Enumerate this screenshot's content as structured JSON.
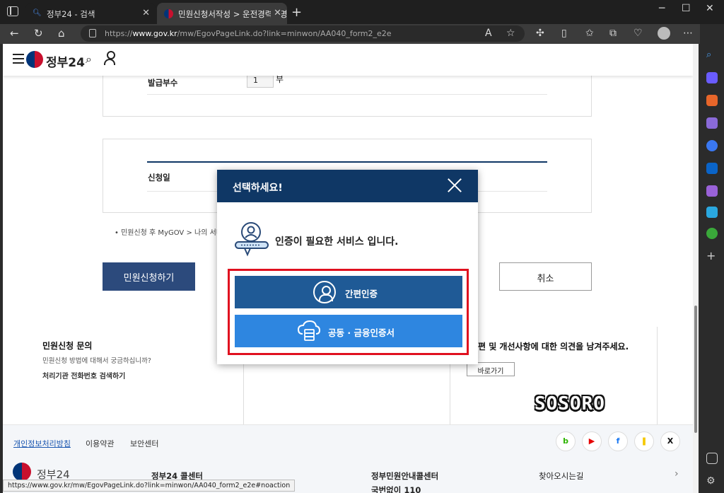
{
  "browser": {
    "tabs": [
      {
        "title": "정부24 - 검색",
        "active": false
      },
      {
        "title": "민원신청서작성 > 운전경력증명",
        "active": true
      }
    ],
    "address": {
      "prefix": "https://",
      "host": "www.gov.kr",
      "path": "/mw/EgovPageLink.do?link=minwon/AA040_form2_e2e"
    },
    "status_url": "https://www.gov.kr/mw/EgovPageLink.do?link=minwon/AA040_form2_e2e#noaction"
  },
  "site": {
    "logo": "정부24"
  },
  "form": {
    "copies_label": "발급부수",
    "copies_value": "1",
    "copies_unit": "부",
    "date_label": "신청일",
    "note": "민원신청 후 MyGOV > 나의 서비스",
    "apply_button": "민원신청하기",
    "cancel_button": "취소"
  },
  "info": {
    "inquiry_title": "민원신청 문의",
    "inquiry_sub": "민원신청 방법에 대해서 궁금하십니까?",
    "inquiry_link": "처리기관 전화번호 검색하기",
    "feedback_text": "편 및 개선사항에 대한 의견을 남겨주세요.",
    "go_button": "바로가기"
  },
  "watermark": "SOSORO",
  "footer": {
    "links": [
      "개인정보처리방침",
      "이용약관",
      "보안센터"
    ],
    "sns": [
      {
        "label": "b",
        "color": "#2db400"
      },
      {
        "label": "▶",
        "color": "#e60000"
      },
      {
        "label": "f",
        "color": "#1877f2"
      },
      {
        "label": "❚",
        "color": "#f5c800"
      },
      {
        "label": "X",
        "color": "#111111"
      }
    ],
    "bottom": {
      "logo": "정부24",
      "callcenter": "정부24 콜센터",
      "gov_center": "정부민원안내콜센터",
      "gov_center_sub": "국번없이 110",
      "directions": "찾아오시는길",
      "arrow": "›"
    }
  },
  "modal": {
    "title": "선택하세요!",
    "message": "인증이 필요한 서비스 입니다.",
    "simple_auth": "간편인증",
    "cert_auth": "공동 · 금융인증서"
  },
  "colors": {
    "modal_header": "#0f3765",
    "simple_auth_button": "#1f5a96",
    "cert_auth_button": "#2e86e0",
    "highlight_frame": "#e0101f",
    "apply_button": "#2c4a7c"
  }
}
